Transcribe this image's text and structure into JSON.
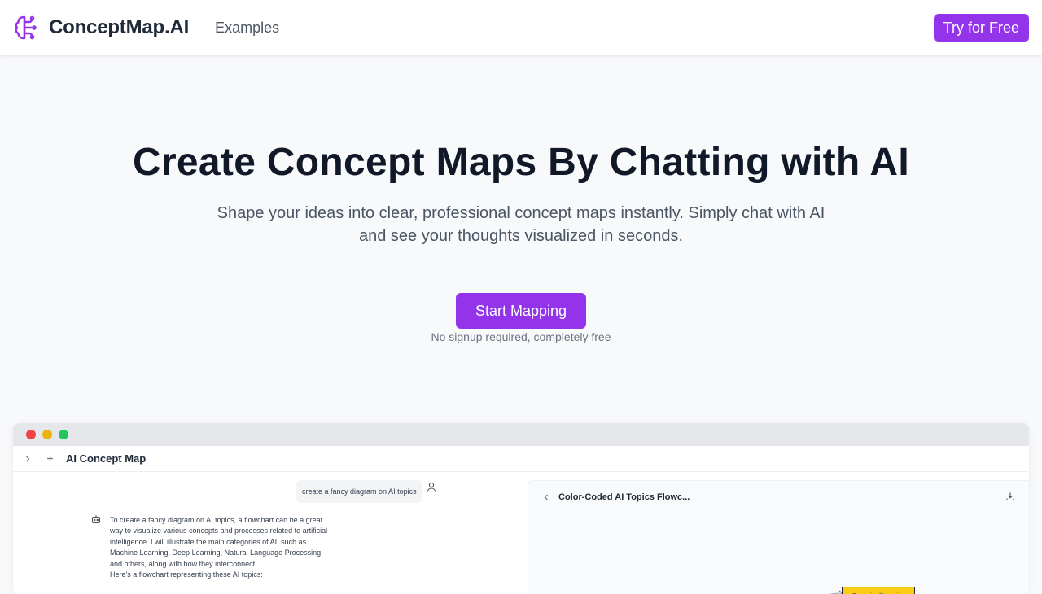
{
  "header": {
    "brand": "ConceptMap.AI",
    "nav_examples": "Examples",
    "cta": "Try for Free"
  },
  "hero": {
    "title": "Create Concept Maps By Chatting with AI",
    "subtitle": "Shape your ideas into clear, professional concept maps instantly. Simply chat with AI and see your thoughts visualized in seconds.",
    "button": "Start Mapping",
    "note": "No signup required, completely free"
  },
  "demo": {
    "app_title": "AI Concept Map",
    "user_message": "create a fancy diagram on AI topics",
    "bot_message": [
      "To create a fancy diagram on AI topics, a flowchart can be a great way to visualize various concepts and processes related to artificial intelligence. I will illustrate the main categories of AI, such as Machine Learning, Deep Learning, Natural Language Processing, and others, along with how they interconnect.",
      "Here's a flowchart representing these AI topics:"
    ],
    "map_title": "Color-Coded AI Topics Flowc...",
    "map_node": "Supervised Learning"
  },
  "colors": {
    "accent": "#9333ea",
    "dot_red": "#ef4444",
    "dot_yellow": "#eab308",
    "dot_green": "#22c55e",
    "node_fill": "#facc15"
  },
  "icons": {
    "logo": "brain-icon",
    "expand": "chevron-right-icon",
    "new": "plus-icon",
    "user": "user-icon",
    "bot": "robot-icon",
    "back": "chevron-left-icon",
    "download": "download-icon"
  }
}
